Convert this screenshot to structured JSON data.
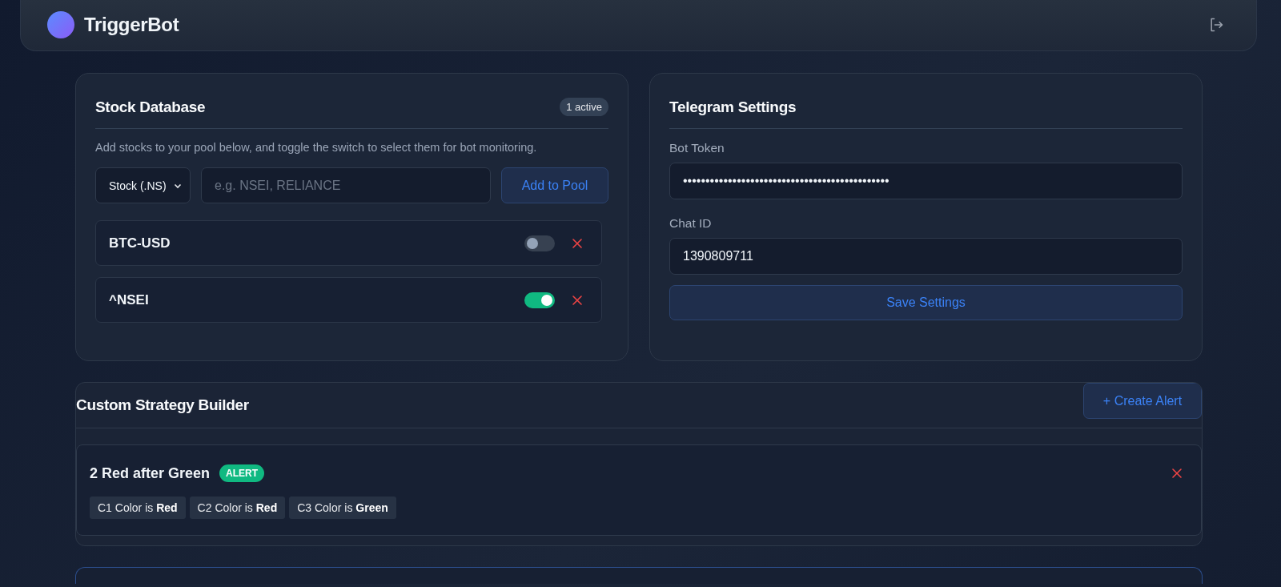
{
  "header": {
    "title": "TriggerBot"
  },
  "stock_database": {
    "title": "Stock Database",
    "badge": "1 active",
    "description": "Add stocks to your pool below, and toggle the switch to select them for bot monitoring.",
    "type_select": {
      "value": "Stock (.NS)"
    },
    "symbol_input": {
      "placeholder": "e.g. NSEI, RELIANCE"
    },
    "add_button": "Add to Pool",
    "stocks": [
      {
        "symbol": "BTC-USD",
        "on": false
      },
      {
        "symbol": "^NSEI",
        "on": true
      }
    ]
  },
  "telegram_settings": {
    "title": "Telegram Settings",
    "fields": [
      {
        "label": "Bot Token",
        "value": "••••••••••••••••••••••••••••••••••••••••••••••"
      },
      {
        "label": "Chat ID",
        "value": "1390809711"
      }
    ],
    "save_button": "Save Settings"
  },
  "strategy_builder": {
    "title": "Custom Strategy Builder",
    "create_button": "+ Create Alert",
    "strategies": [
      {
        "name": "2 Red after Green",
        "tag": "ALERT",
        "conditions": [
          "C1 Color is **Red**",
          "C2 Color is **Red**",
          "C3 Color is **Green**"
        ]
      }
    ]
  }
}
